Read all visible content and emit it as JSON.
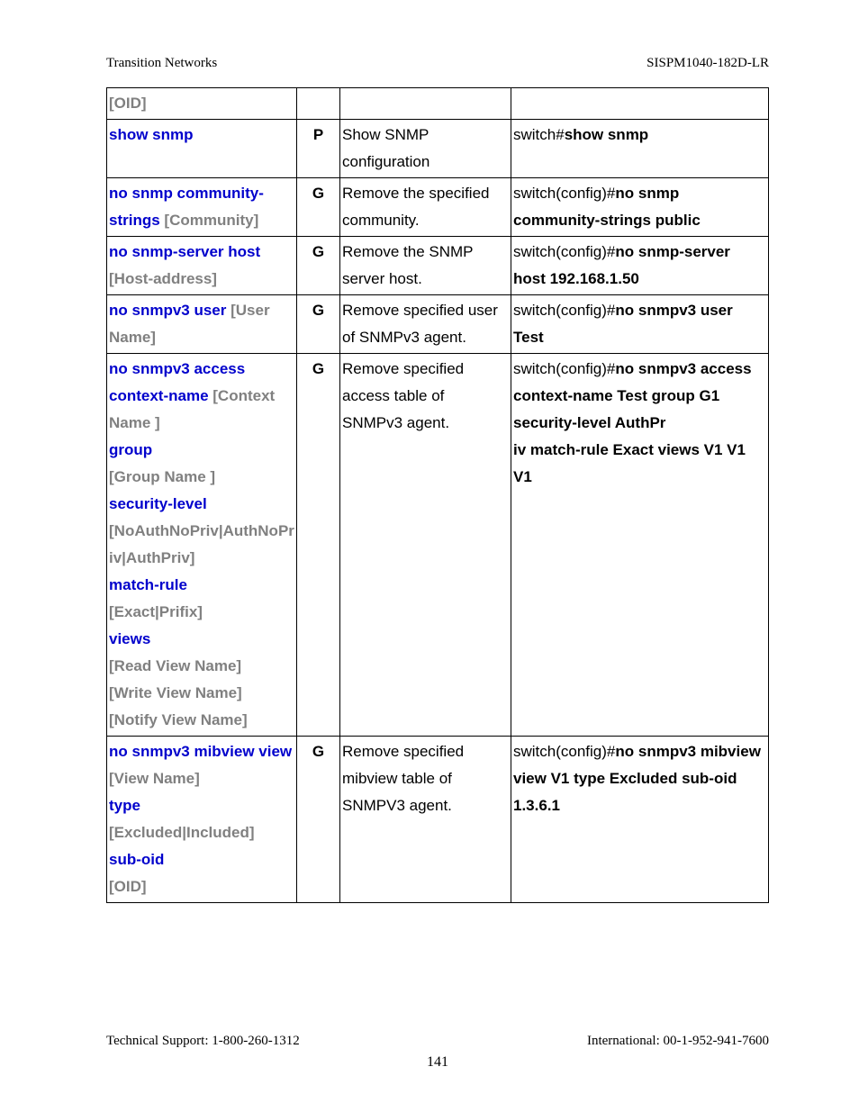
{
  "header": {
    "left": "Transition Networks",
    "right": "SISPM1040-182D-LR"
  },
  "footer": {
    "left": "Technical Support: 1-800-260-1312",
    "right": "International: 00-1-952-941-7600",
    "page": "141"
  },
  "par": {
    "oid": "[OID]",
    "community": "[Community]",
    "hostaddr": "[Host-address]",
    "username": "[User Name]",
    "contextname": "[Context Name ]",
    "groupname": "[Group Name ]",
    "seclevel": "[NoAuthNoPriv|AuthNoPriv|AuthPriv]",
    "matchrule": "[Exact|Prifix]",
    "readview": "[Read View Name]",
    "writeview": "[Write View Name]",
    "notifyview": "[Notify View Name]",
    "viewname": "[View Name]",
    "viewtype": "[Excluded|Included]"
  },
  "kw": {
    "show_snmp": "show snmp",
    "no_snmp_community_strings": "no snmp community-strings ",
    "no_snmp_server_host": "no snmp-server host ",
    "no_snmpv3_user": "no snmpv3 user ",
    "no_snmpv3_access_context_name": "no snmpv3 access context-name ",
    "group": "group",
    "security_level": "security-level",
    "match_rule": "match-rule",
    "views": "views",
    "no_snmpv3_mibview_view": "no snmpv3 mibview view",
    "type": "type",
    "sub_oid": "sub-oid"
  },
  "mode": {
    "p": "P",
    "g": "G"
  },
  "desc": {
    "show_snmp": "Show SNMP configuration",
    "remove_community": "Remove the specified community.",
    "remove_host": "Remove the SNMP server host.",
    "remove_user": "Remove specified user of SNMPv3 agent.",
    "remove_access": "Remove specified access table of SNMPv3 agent.",
    "remove_mibview": "Remove specified mibview table of SNMPV3 agent."
  },
  "ex": {
    "r2_prefix": "switch#",
    "r2_cmd": "show snmp",
    "cfg_prefix": "switch(config)#",
    "r3_cmd": "no snmp community-strings public",
    "r4_cmd": "no snmp-server host 192.168.1.50",
    "r5_cmd": "no snmpv3 user Test",
    "r6_cmd": "no snmpv3 access context-name Test group G1 security-level AuthPr",
    "r6_cmd2": "iv match-rule Exact views V1 V1 V1",
    "r7_cmd": "no snmpv3 mibview view V1 type Excluded sub-oid 1.3.6.1"
  }
}
